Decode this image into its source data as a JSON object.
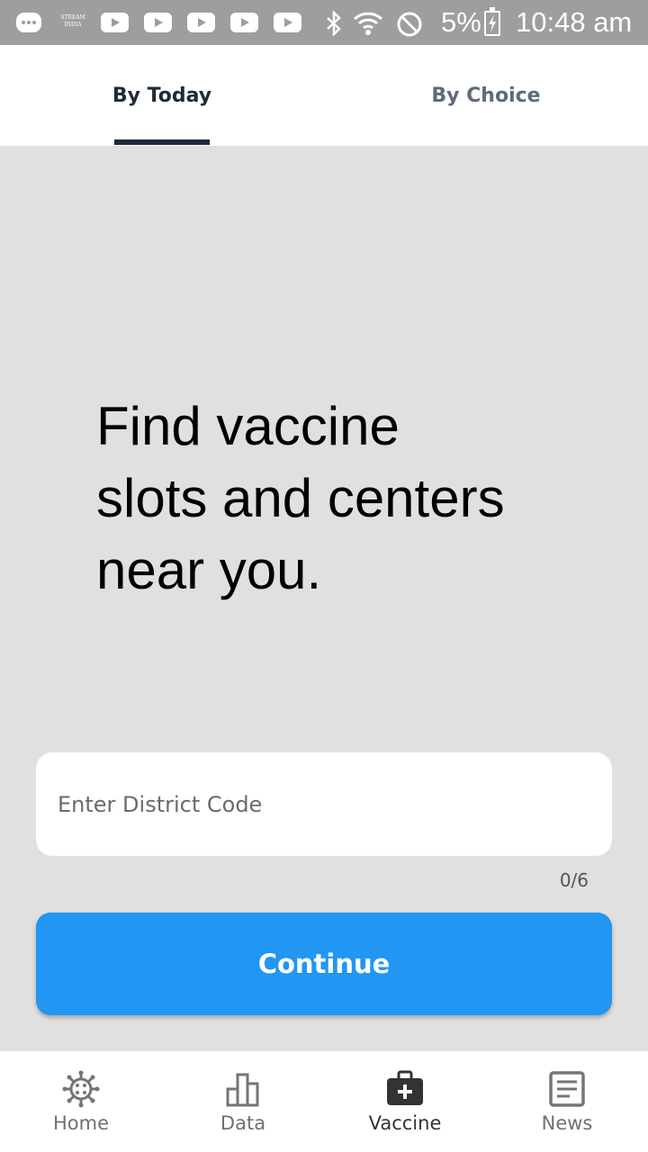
{
  "status_bar": {
    "stream_badge": "STREAM INDIA",
    "battery_percent": "5%",
    "time": "10:48 am",
    "icons": [
      "message-icon",
      "stream-india-icon",
      "youtube-icon",
      "youtube-icon",
      "youtube-icon",
      "youtube-icon",
      "youtube-icon",
      "bluetooth-icon",
      "wifi-icon",
      "do-not-disturb-icon",
      "battery-charging-icon"
    ]
  },
  "tabs": [
    {
      "label": "By Today",
      "active": true
    },
    {
      "label": "By Choice",
      "active": false
    }
  ],
  "main": {
    "headline": "Find vaccine\nslots and centers\nnear you.",
    "district_input": {
      "value": "",
      "placeholder": "Enter District Code"
    },
    "counter": "0/6",
    "continue_label": "Continue"
  },
  "bottom_nav": [
    {
      "label": "Home",
      "icon": "virus-icon",
      "active": false
    },
    {
      "label": "Data",
      "icon": "bar-chart-icon",
      "active": false
    },
    {
      "label": "Vaccine",
      "icon": "medical-kit-icon",
      "active": true
    },
    {
      "label": "News",
      "icon": "article-icon",
      "active": false
    }
  ],
  "colors": {
    "status_bar": "#9e9e9e",
    "background": "#e0e0e0",
    "tab_indicator": "#1d2a3d",
    "accent_button": "#2196f3"
  }
}
